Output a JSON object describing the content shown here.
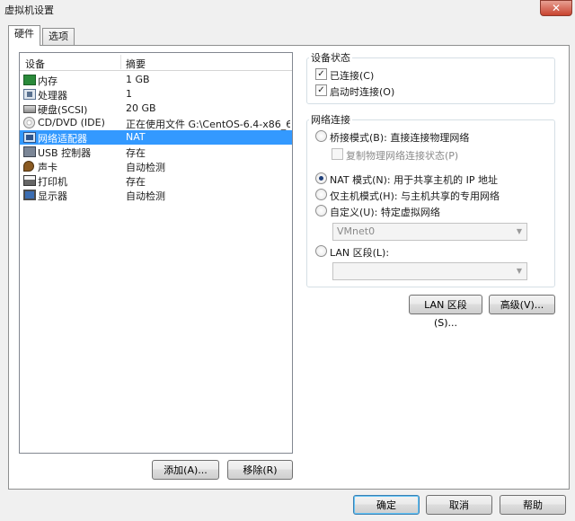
{
  "window": {
    "title": "虚拟机设置",
    "close_label": "✕"
  },
  "tabs": [
    {
      "label": "硬件"
    },
    {
      "label": "选项"
    }
  ],
  "device_list": {
    "columns": {
      "device": "设备",
      "summary": "摘要"
    },
    "rows": [
      {
        "name": "内存",
        "summary": "1 GB",
        "icon": "memory-icon"
      },
      {
        "name": "处理器",
        "summary": "1",
        "icon": "cpu-icon"
      },
      {
        "name": "硬盘(SCSI)",
        "summary": "20 GB",
        "icon": "hard-disk-icon"
      },
      {
        "name": "CD/DVD (IDE)",
        "summary": "正在使用文件 G:\\CentOS-6.4-x86_6...",
        "icon": "cd-icon"
      },
      {
        "name": "网络适配器",
        "summary": "NAT",
        "icon": "network-icon",
        "selected": true
      },
      {
        "name": "USB 控制器",
        "summary": "存在",
        "icon": "usb-icon"
      },
      {
        "name": "声卡",
        "summary": "自动检测",
        "icon": "sound-icon"
      },
      {
        "name": "打印机",
        "summary": "存在",
        "icon": "printer-icon"
      },
      {
        "name": "显示器",
        "summary": "自动检测",
        "icon": "display-icon"
      }
    ]
  },
  "buttons": {
    "add": "添加(A)...",
    "remove": "移除(R)",
    "ok": "确定",
    "cancel": "取消",
    "help": "帮助",
    "lan_segments": "LAN 区段(S)...",
    "advanced": "高级(V)..."
  },
  "device_status": {
    "title": "设备状态",
    "connected": {
      "label": "已连接(C)",
      "checked": true
    },
    "connect_at_power_on": {
      "label": "启动时连接(O)",
      "checked": true
    }
  },
  "network_connection": {
    "title": "网络连接",
    "options": [
      {
        "label": "桥接模式(B): 直接连接物理网络",
        "selected": false
      },
      {
        "label": "NAT 模式(N): 用于共享主机的 IP 地址",
        "selected": true
      },
      {
        "label": "仅主机模式(H): 与主机共享的专用网络",
        "selected": false
      },
      {
        "label": "自定义(U): 特定虚拟网络",
        "selected": false
      },
      {
        "label": "LAN 区段(L):",
        "selected": false
      }
    ],
    "replicate_state": {
      "label": "复制物理网络连接状态(P)",
      "checked": false
    },
    "custom_combo_value": "VMnet0",
    "lan_combo_value": ""
  },
  "icons": {
    "check": "✓",
    "dropdown": "▼"
  }
}
